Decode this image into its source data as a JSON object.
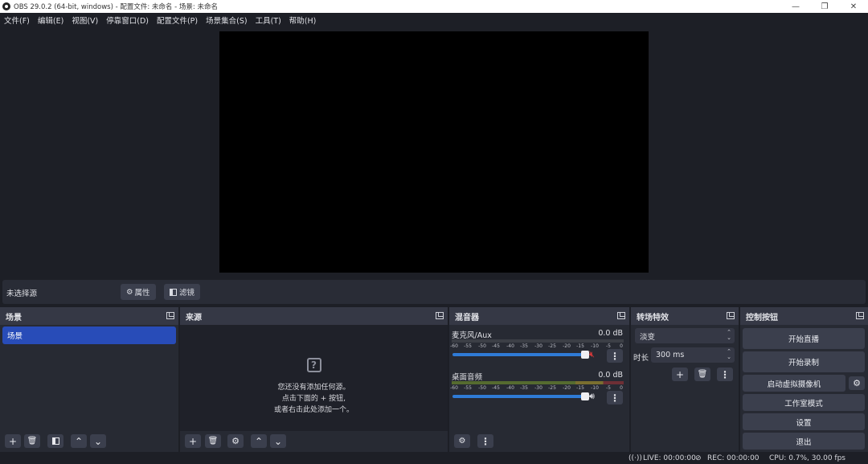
{
  "window": {
    "title": "OBS 29.0.2 (64-bit, windows) - 配置文件: 未命名 - 场景: 未命名",
    "min_glyph": "—",
    "max_glyph": "❐",
    "close_glyph": "✕"
  },
  "menu": [
    "文件(F)",
    "编辑(E)",
    "视图(V)",
    "停靠窗口(D)",
    "配置文件(P)",
    "场景集合(S)",
    "工具(T)",
    "帮助(H)"
  ],
  "source_bar": {
    "no_selection": "未选择源",
    "properties_label": "属性",
    "filters_label": "滤镜"
  },
  "scenes": {
    "title": "场景",
    "items": [
      "场景"
    ]
  },
  "sources": {
    "title": "来源",
    "empty_lines": [
      "您还没有添加任何源。",
      "点击下面的 + 按钮,",
      "或者右击此处添加一个。"
    ]
  },
  "mixer": {
    "title": "混音器",
    "ticks": [
      "-60",
      "-55",
      "-50",
      "-45",
      "-40",
      "-35",
      "-30",
      "-25",
      "-20",
      "-15",
      "-10",
      "-5",
      "0"
    ],
    "channels": [
      {
        "name": "麦克风/Aux",
        "db": "0.0 dB",
        "muted": true,
        "volume": 1.0
      },
      {
        "name": "桌面音频",
        "db": "0.0 dB",
        "muted": false,
        "volume": 1.0
      }
    ]
  },
  "transitions": {
    "title": "转场特效",
    "selected": "淡变",
    "duration_label": "时长",
    "duration_value": "300 ms"
  },
  "controls": {
    "title": "控制按钮",
    "start_stream": "开始直播",
    "start_record": "开始录制",
    "virtual_cam": "启动虚拟摄像机",
    "studio_mode": "工作室模式",
    "settings": "设置",
    "exit": "退出"
  },
  "status": {
    "live": "LIVE: 00:00:00",
    "rec": "REC: 00:00:00",
    "cpu": "CPU: 0.7%, 30.00 fps"
  },
  "colors": {
    "accent": "#284cb8",
    "volume": "#2f7bd6",
    "mute": "#d83a3a"
  }
}
